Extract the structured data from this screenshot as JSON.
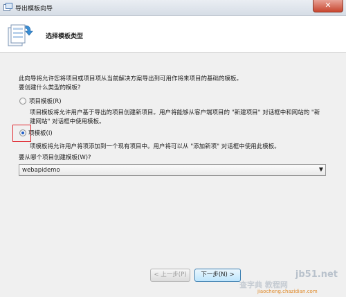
{
  "window": {
    "title": "导出模板向导",
    "close_glyph": "✕"
  },
  "header": {
    "title": "选择模板类型"
  },
  "intro": {
    "line1": "此向导将允许您将项目或项目项从当前解决方案导出到可用作将来项目的基础的模板。",
    "question": "要创建什么类型的模板?"
  },
  "options": [
    {
      "label": "项目模板(R)",
      "selected": false,
      "desc_line1": "项目模板将允许用户基于导出的项目创建新项目。用户将能够从客户端项目的 \"新建项目\" 对话框中和网站的 \"新",
      "desc_line2": "建网站\" 对话框中使用模板。"
    },
    {
      "label": "项模板(I)",
      "selected": true,
      "desc_line1": "项模板将允许用户将项添加到一个现有项目中。用户将可以从 \"添加新项\" 对话框中使用此模板。"
    }
  ],
  "project_select": {
    "label": "要从哪个项目创建模板(W)?",
    "value": "webapidemo"
  },
  "buttons": {
    "back": "< 上一步(P)",
    "next": "下一步(N) >"
  },
  "watermark": {
    "line1": "jb51.net",
    "line2": "查字典 教程网",
    "line3": "jiaocheng.chazidian.com"
  },
  "colors": {
    "accent": "#1e5ec8",
    "highlight_box": "#e0262d",
    "close_button": "#c8462f"
  }
}
